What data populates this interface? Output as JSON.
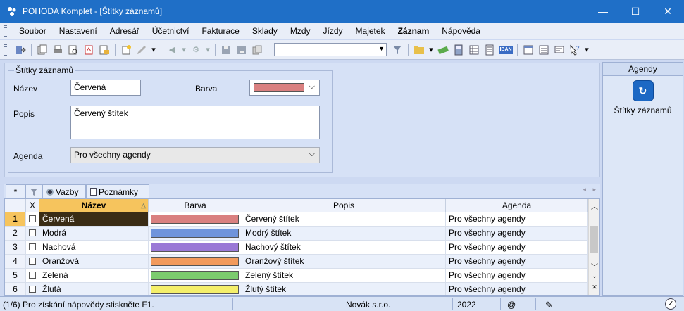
{
  "window": {
    "title": "POHODA Komplet - [Štítky záznamů]",
    "minimize": "—",
    "maximize": "☐",
    "close": "✕"
  },
  "menu": [
    "Soubor",
    "Nastavení",
    "Adresář",
    "Účetnictví",
    "Fakturace",
    "Sklady",
    "Mzdy",
    "Jízdy",
    "Majetek",
    "Záznam",
    "Nápověda"
  ],
  "menu_bold_index": 9,
  "form": {
    "group_title": "Štítky záznamů",
    "name_label": "Název",
    "name_value": "Červená",
    "color_label": "Barva",
    "color_value": "#d98080",
    "desc_label": "Popis",
    "desc_value": "Červený štítek",
    "agenda_label": "Agenda",
    "agenda_value": "Pro všechny agendy"
  },
  "side": {
    "header": "Agendy",
    "item_label": "Štítky záznamů"
  },
  "tabs": [
    {
      "label": "*",
      "icon": "asterisk-icon"
    },
    {
      "label": "",
      "icon": "filter-icon"
    },
    {
      "label": "Vazby",
      "icon": "link-icon"
    },
    {
      "label": "Poznámky",
      "icon": "note-icon"
    }
  ],
  "grid": {
    "headers": {
      "x": "X",
      "name": "Název",
      "color": "Barva",
      "desc": "Popis",
      "agenda": "Agenda"
    },
    "rows": [
      {
        "num": "1",
        "name": "Červená",
        "color": "#d98080",
        "desc": "Červený štítek",
        "agenda": "Pro všechny agendy"
      },
      {
        "num": "2",
        "name": "Modrá",
        "color": "#6f94dc",
        "desc": "Modrý štítek",
        "agenda": "Pro všechny agendy"
      },
      {
        "num": "3",
        "name": "Nachová",
        "color": "#9a78d6",
        "desc": "Nachový štítek",
        "agenda": "Pro všechny agendy"
      },
      {
        "num": "4",
        "name": "Oranžová",
        "color": "#f29a5c",
        "desc": "Oranžový štítek",
        "agenda": "Pro všechny agendy"
      },
      {
        "num": "5",
        "name": "Zelená",
        "color": "#7ccc6e",
        "desc": "Zelený štítek",
        "agenda": "Pro všechny agendy"
      },
      {
        "num": "6",
        "name": "Žlutá",
        "color": "#f4ef6a",
        "desc": "Žlutý štítek",
        "agenda": "Pro všechny agendy"
      }
    ]
  },
  "status": {
    "help": "(1/6) Pro získání nápovědy stiskněte F1.",
    "company": "Novák s.r.o.",
    "year": "2022",
    "at": "@"
  }
}
